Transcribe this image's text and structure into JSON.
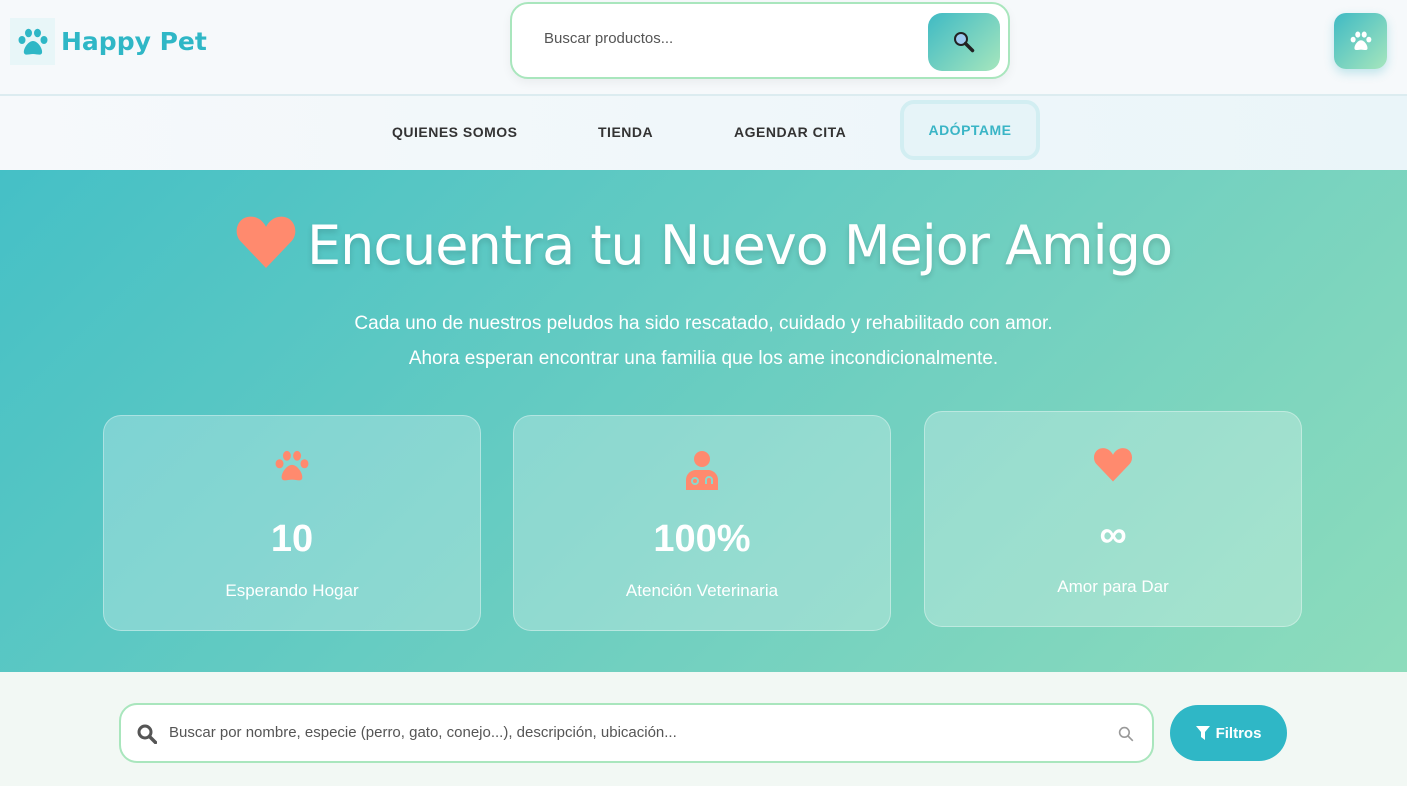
{
  "header": {
    "brand": "Happy Pet",
    "search_placeholder": "Buscar productos..."
  },
  "nav": {
    "items": [
      "QUIENES SOMOS",
      "TIENDA",
      "AGENDAR CITA",
      "ADÓPTAME"
    ]
  },
  "hero": {
    "title": "Encuentra tu Nuevo Mejor Amigo",
    "subtitle_line1": "Cada uno de nuestros peludos ha sido rescatado, cuidado y rehabilitado con amor.",
    "subtitle_line2": "Ahora esperan encontrar una familia que los ame incondicionalmente.",
    "stats": [
      {
        "icon": "paw-icon",
        "value": "10",
        "label": "Esperando Hogar"
      },
      {
        "icon": "doctor-icon",
        "value": "100%",
        "label": "Atención Veterinaria"
      },
      {
        "icon": "heart-icon",
        "value": "∞",
        "label": "Amor para Dar"
      }
    ]
  },
  "filter": {
    "search_placeholder": "Buscar por nombre, especie (perro, gato, conejo...), descripción, ubicación...",
    "filters_label": "Filtros"
  },
  "colors": {
    "brand": "#2fb7c6",
    "accent": "#ff8a6e"
  }
}
